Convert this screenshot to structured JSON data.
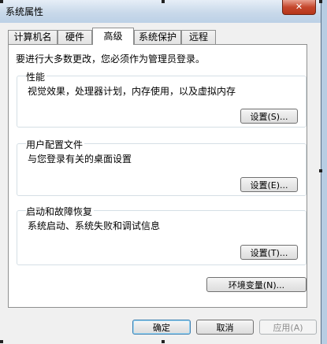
{
  "window": {
    "title": "系统属性",
    "close_glyph": "✕"
  },
  "tabs": [
    {
      "label": "计算机名",
      "active": false
    },
    {
      "label": "硬件",
      "active": false
    },
    {
      "label": "高级",
      "active": true
    },
    {
      "label": "系统保护",
      "active": false
    },
    {
      "label": "远程",
      "active": false
    }
  ],
  "admin_note": "要进行大多数更改，您必须作为管理员登录。",
  "groups": {
    "performance": {
      "title": "性能",
      "desc": "视觉效果，处理器计划，内存使用，以及虚拟内存",
      "button": "设置(S)..."
    },
    "user_profiles": {
      "title": "用户配置文件",
      "desc": "与您登录有关的桌面设置",
      "button": "设置(E)..."
    },
    "startup_recovery": {
      "title": "启动和故障恢复",
      "desc": "系统启动、系统失败和调试信息",
      "button": "设置(T)..."
    }
  },
  "env_button": "环境变量(N)...",
  "footer": {
    "ok": "确定",
    "cancel": "取消",
    "apply": "应用(A)"
  }
}
